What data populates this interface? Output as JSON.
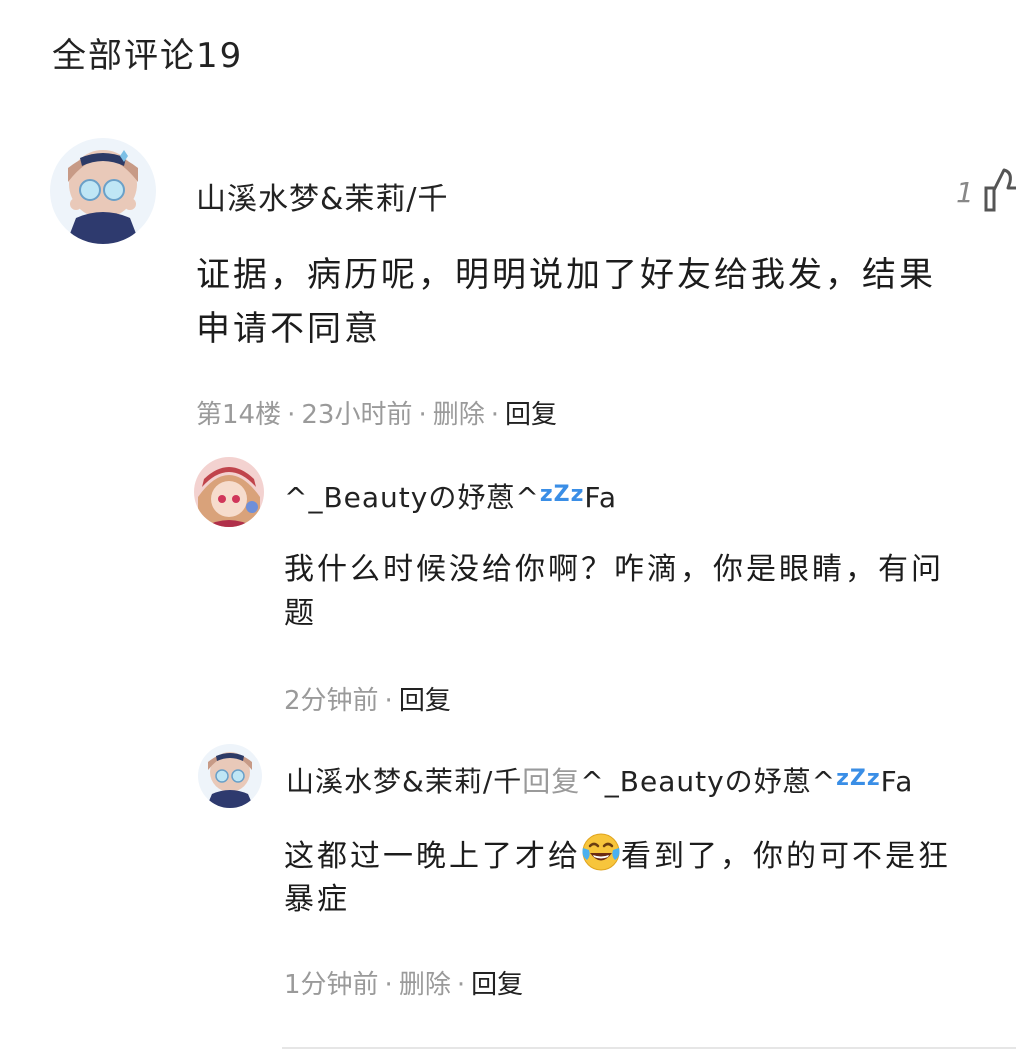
{
  "header": {
    "title": "全部评论19"
  },
  "comment": {
    "username": "山溪水梦&茉莉/千",
    "like_count": "1",
    "content_line1": "证据，病历呢，明明说加了好友给我发，结果",
    "content_line2": "申请不同意",
    "floor": "第14楼",
    "time": "23小时前",
    "delete_label": "删除",
    "reply_label": "回复"
  },
  "replies": [
    {
      "username": "^_Beautyの妤蒽^",
      "username_badge": "Fa",
      "sleep_icon_text": "zZz",
      "content_line1": "我什么时候没给你啊？咋滴，你是眼睛，有问",
      "content_line2": "题",
      "time": "2分钟前",
      "reply_label": "回复"
    },
    {
      "username": "山溪水梦&茉莉/千",
      "reply_word": "回复",
      "reply_target": "^_Beautyの妤蒽^",
      "reply_target_badge": "Fa",
      "sleep_icon_text": "zZz",
      "content_part1": "这都过一晚上了才给",
      "content_part2": "看到了，你的可不是狂",
      "content_line2": "暴症",
      "time": "1分钟前",
      "delete_label": "删除",
      "reply_label": "回复"
    }
  ],
  "colors": {
    "text": "#1c1c1c",
    "meta": "#9a9a9a",
    "zzz_blue": "#3a8ee6",
    "divider": "#e6e6e6"
  },
  "icons": {
    "like": "thumbs-up-icon",
    "emoji": "laughing-tears-emoji"
  }
}
